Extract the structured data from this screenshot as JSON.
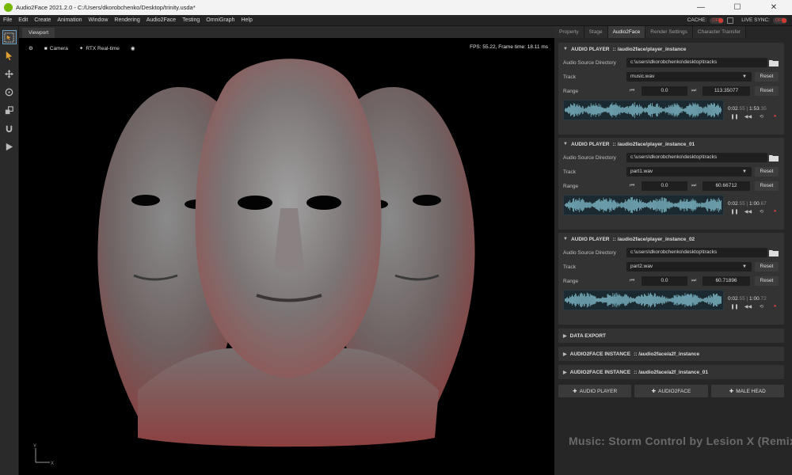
{
  "window": {
    "title": "Audio2Face 2021.2.0 - C:/Users/dkorobchenko/Desktop/trinity.usda*",
    "minimize": "—",
    "maximize": "☐",
    "close": "✕"
  },
  "menu": {
    "items": [
      "File",
      "Edit",
      "Create",
      "Animation",
      "Window",
      "Rendering",
      "Audio2Face",
      "Testing",
      "OmniGraph",
      "Help"
    ],
    "cache_label": "CACHE:",
    "cache_state": "OFF",
    "live_sync_label": "LIVE SYNC:",
    "live_sync_state": "OFF"
  },
  "viewport": {
    "tab": "Viewport",
    "camera_label": "Camera",
    "render_mode": "RTX Real-time",
    "fps_text": "FPS: 55.22, Frame time: 18.11 ms",
    "axis_y": "Y",
    "axis_x": "X"
  },
  "credit": "Music: Storm Control by Lesion X (Remix)",
  "panel": {
    "tabs": [
      "Property",
      "Stage",
      "Audio2Face",
      "Render Settings",
      "Character Transfer"
    ],
    "active_tab": "Audio2Face",
    "labels": {
      "source_dir": "Audio Source Directory",
      "track": "Track",
      "range": "Range",
      "reset": "Reset"
    },
    "players": [
      {
        "title": "AUDIO PLAYER",
        "path": ":: /audio2face/player_instance",
        "directory": "c:\\users\\dkorobchenko\\desktop\\tracks",
        "track": "music.wav",
        "range_start": "0.0",
        "range_end": "113.35077",
        "time_current": "0:02",
        "time_current_frac": ".55",
        "time_total": "1:53",
        "time_total_frac": ".35"
      },
      {
        "title": "AUDIO PLAYER",
        "path": ":: /audio2face/player_instance_01",
        "directory": "c:\\users\\dkorobchenko\\desktop\\tracks",
        "track": "part1.wav",
        "range_start": "0.0",
        "range_end": "60.66712",
        "time_current": "0:02",
        "time_current_frac": ".55",
        "time_total": "1:00",
        "time_total_frac": ".67"
      },
      {
        "title": "AUDIO PLAYER",
        "path": ":: /audio2face/player_instance_02",
        "directory": "c:\\users\\dkorobchenko\\desktop\\tracks",
        "track": "part2.wav",
        "range_start": "0.0",
        "range_end": "60.71896",
        "time_current": "0:02",
        "time_current_frac": ".55",
        "time_total": "1:00",
        "time_total_frac": ".72"
      }
    ],
    "collapsed": [
      {
        "title": "DATA EXPORT",
        "path": ""
      },
      {
        "title": "AUDIO2FACE INSTANCE",
        "path": ":: /audio2face/a2f_instance"
      },
      {
        "title": "AUDIO2FACE INSTANCE",
        "path": ":: /audio2face/a2f_instance_01"
      }
    ],
    "add_buttons": [
      "AUDIO PLAYER",
      "AUDIO2FACE",
      "MALE HEAD"
    ]
  },
  "colors": {
    "accent_green": "#76b900",
    "off_red": "#d23a32",
    "waveform": "#7fb8c8"
  }
}
